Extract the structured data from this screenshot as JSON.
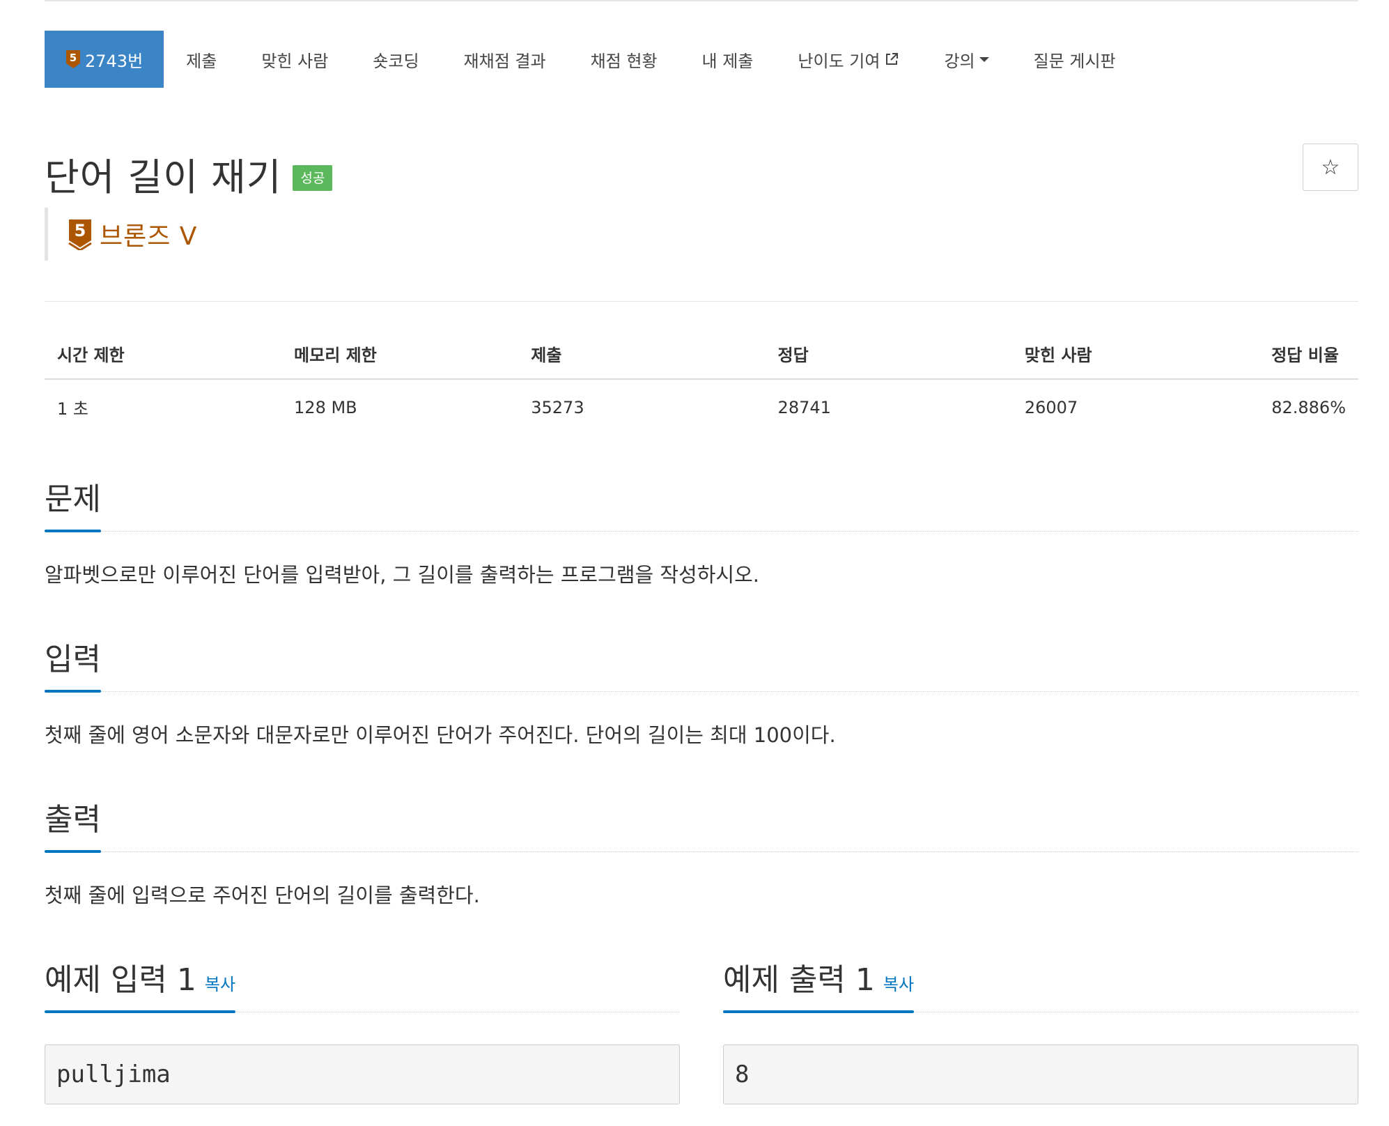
{
  "tabs": [
    {
      "label": "2743번",
      "active": true,
      "tier_badge": "5"
    },
    {
      "label": "제출"
    },
    {
      "label": "맞힌 사람"
    },
    {
      "label": "숏코딩"
    },
    {
      "label": "재채점 결과"
    },
    {
      "label": "채점 현황"
    },
    {
      "label": "내 제출"
    },
    {
      "label": "난이도 기여"
    },
    {
      "label": "강의"
    },
    {
      "label": "질문 게시판"
    }
  ],
  "problem": {
    "title": "단어 길이 재기",
    "status_badge": "성공",
    "tier_number": "5",
    "tier_label": "브론즈 V",
    "star": "☆"
  },
  "stats": {
    "headers": [
      "시간 제한",
      "메모리 제한",
      "제출",
      "정답",
      "맞힌 사람",
      "정답 비율"
    ],
    "values": [
      "1 초",
      "128 MB",
      "35273",
      "28741",
      "26007",
      "82.886%"
    ]
  },
  "sections": {
    "description": {
      "title": "문제",
      "text": "알파벳으로만 이루어진 단어를 입력받아, 그 길이를 출력하는 프로그램을 작성하시오."
    },
    "input": {
      "title": "입력",
      "text": "첫째 줄에 영어 소문자와 대문자로만 이루어진 단어가 주어진다. 단어의 길이는 최대 100이다."
    },
    "output": {
      "title": "출력",
      "text": "첫째 줄에 입력으로 주어진 단어의 길이를 출력한다."
    }
  },
  "samples": {
    "input": {
      "title": "예제 입력 1",
      "copy_label": "복사",
      "content": "pulljima"
    },
    "output": {
      "title": "예제 출력 1",
      "copy_label": "복사",
      "content": "8"
    }
  },
  "colors": {
    "accent": "#3b84c6",
    "tier_bronze": "#ad5600",
    "success": "#5cb85c",
    "link": "#0076c0"
  }
}
